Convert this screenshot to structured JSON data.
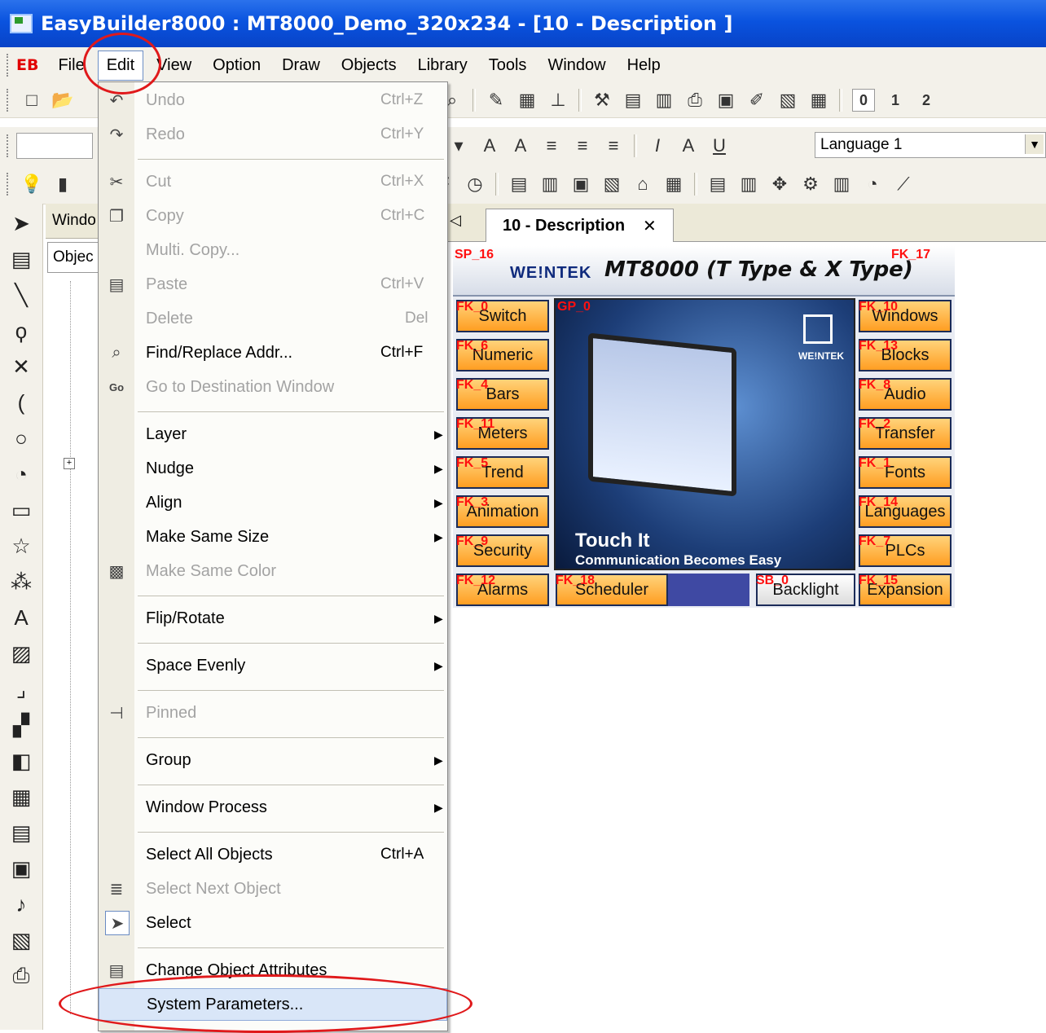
{
  "window": {
    "title": "EasyBuilder8000 : MT8000_Demo_320x234 - [10 - Description ]"
  },
  "menubar": {
    "logo": "EB",
    "items": [
      "File",
      "Edit",
      "View",
      "Option",
      "Draw",
      "Objects",
      "Library",
      "Tools",
      "Window",
      "Help"
    ]
  },
  "toolbar": {
    "language": "Language 1",
    "digits": [
      "0",
      "1",
      "2"
    ]
  },
  "object_pane": {
    "header": "Windo",
    "tab": "Objec"
  },
  "document_tab": {
    "label": "10 - Description",
    "close": "✕"
  },
  "hmi": {
    "tags": {
      "sp": "SP_16",
      "fk17": "FK_17",
      "gp": "GP_0",
      "sb": "SB_0"
    },
    "brand": "WE!NTEK",
    "model_title": "MT8000 (T Type & X Type)",
    "left_buttons": [
      {
        "label": "Switch",
        "tag": "FK_0"
      },
      {
        "label": "Numeric",
        "tag": "FK_6"
      },
      {
        "label": "Bars",
        "tag": "FK_4"
      },
      {
        "label": "Meters",
        "tag": "FK_11"
      },
      {
        "label": "Trend",
        "tag": "FK_5"
      },
      {
        "label": "Animation",
        "tag": "FK_3"
      },
      {
        "label": "Security",
        "tag": "FK_9"
      },
      {
        "label": "Alarms",
        "tag": "FK_12"
      }
    ],
    "right_buttons": [
      {
        "label": "Windows",
        "tag": "FK_10"
      },
      {
        "label": "Blocks",
        "tag": "FK_13"
      },
      {
        "label": "Audio",
        "tag": "FK_8"
      },
      {
        "label": "Transfer",
        "tag": "FK_2"
      },
      {
        "label": "Fonts",
        "tag": "FK_1"
      },
      {
        "label": "Languages",
        "tag": "FK_14"
      },
      {
        "label": "PLCs",
        "tag": "FK_7"
      },
      {
        "label": "Expansion",
        "tag": "FK_15"
      }
    ],
    "scheduler": {
      "label": "Scheduler",
      "tag": "FK_18"
    },
    "backlight": "Backlight",
    "image_brand": "WE!NTEK",
    "touch_line1": "Touch It",
    "touch_line2": "Communication Becomes Easy"
  },
  "edit_menu": [
    {
      "label": "Undo",
      "shortcut": "Ctrl+Z",
      "disabled": true,
      "icon": "undo-icon"
    },
    {
      "label": "Redo",
      "shortcut": "Ctrl+Y",
      "disabled": true,
      "icon": "redo-icon"
    },
    {
      "label": "Cut",
      "shortcut": "Ctrl+X",
      "disabled": true,
      "icon": "scissors-icon"
    },
    {
      "label": "Copy",
      "shortcut": "Ctrl+C",
      "disabled": true,
      "icon": "copy-icon"
    },
    {
      "label": "Multi. Copy...",
      "shortcut": "",
      "disabled": true
    },
    {
      "label": "Paste",
      "shortcut": "Ctrl+V",
      "disabled": true,
      "icon": "paste-icon"
    },
    {
      "label": "Delete",
      "shortcut": "Del",
      "disabled": true
    },
    {
      "label": "Find/Replace Addr...",
      "shortcut": "Ctrl+F",
      "disabled": false,
      "icon": "binoculars-icon"
    },
    {
      "label": "Go to Destination Window",
      "shortcut": "",
      "disabled": true,
      "icon": "go-icon"
    },
    {
      "label": "Layer",
      "submenu": true
    },
    {
      "label": "Nudge",
      "submenu": true
    },
    {
      "label": "Align",
      "submenu": true
    },
    {
      "label": "Make Same Size",
      "submenu": true
    },
    {
      "label": "Make Same Color",
      "disabled": true,
      "icon": "color-icon"
    },
    {
      "label": "Flip/Rotate",
      "submenu": true
    },
    {
      "label": "Space Evenly",
      "submenu": true
    },
    {
      "label": "Pinned",
      "disabled": true,
      "icon": "pin-icon"
    },
    {
      "label": "Group",
      "submenu": true
    },
    {
      "label": "Window Process",
      "submenu": true
    },
    {
      "label": "Select All Objects",
      "shortcut": "Ctrl+A"
    },
    {
      "label": "Select Next Object",
      "disabled": true,
      "icon": "next-object-icon"
    },
    {
      "label": "Select",
      "icon": "pointer-icon"
    },
    {
      "label": "Change Object Attributes",
      "icon": "attributes-icon"
    },
    {
      "label": "System Parameters...",
      "highlighted": true
    }
  ],
  "colors": {
    "title_bar": "#0a53df",
    "annotation": "#e0191b",
    "hmi_button": "#ff9e22"
  }
}
